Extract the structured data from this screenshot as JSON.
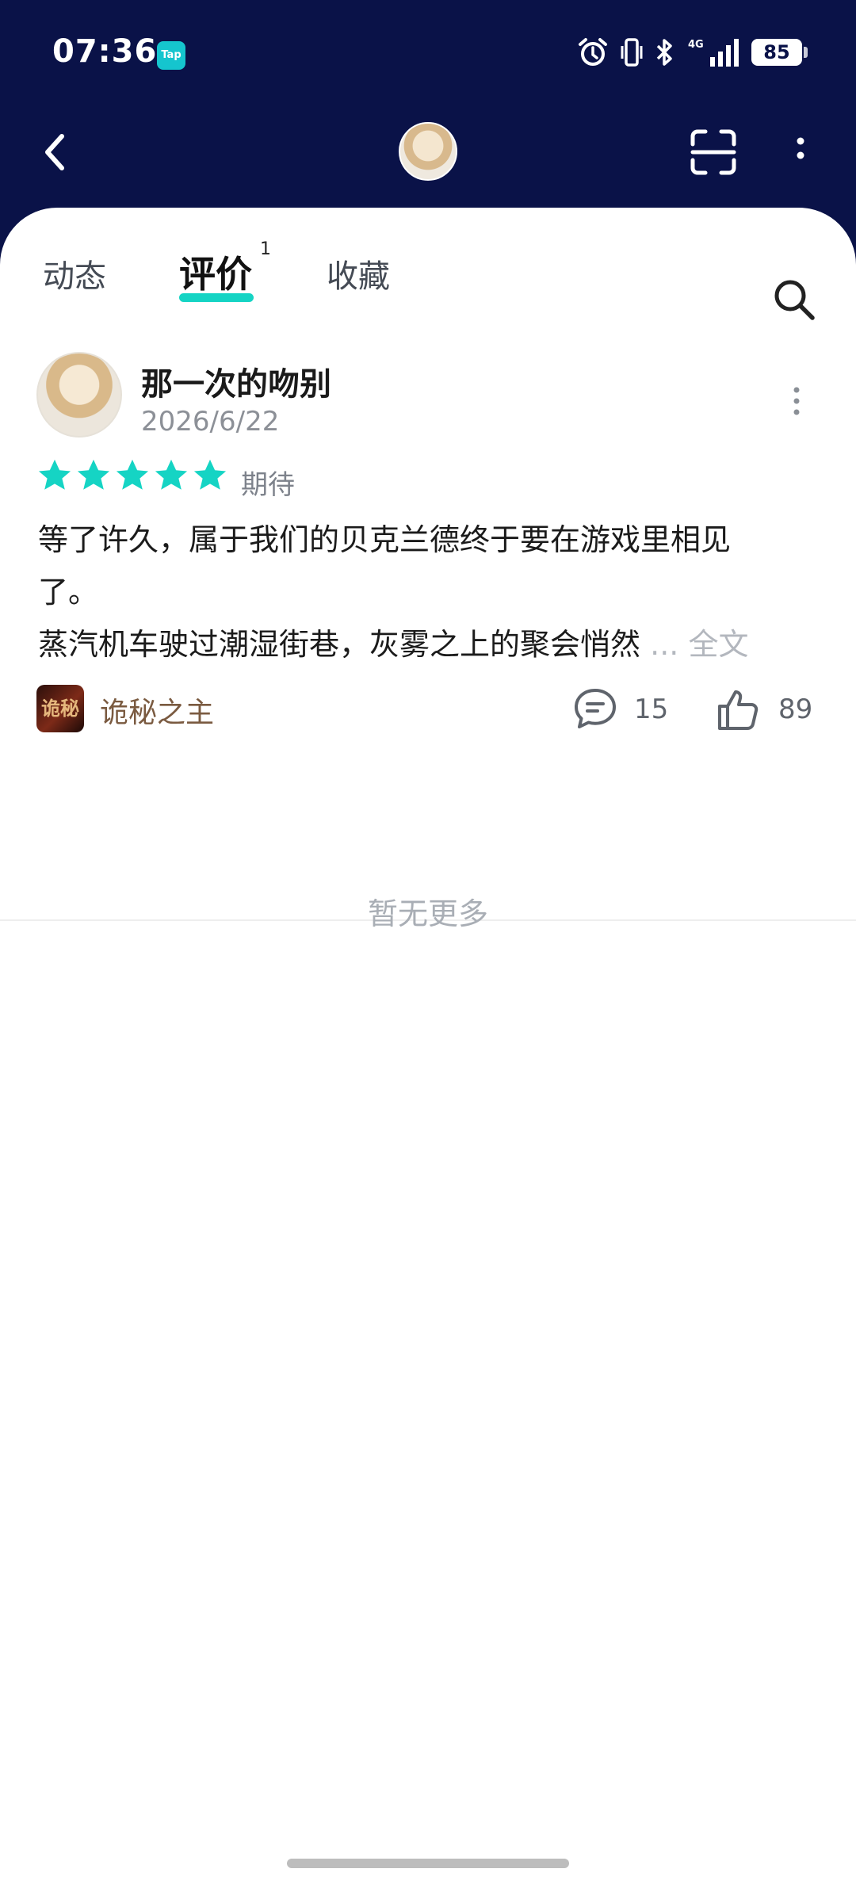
{
  "status_bar": {
    "time": "07:36",
    "app_badge": "Tap",
    "battery": "85",
    "network": "4G",
    "icons": [
      "alarm-icon",
      "vibrate-icon",
      "bluetooth-icon",
      "signal-icon",
      "battery-icon"
    ]
  },
  "header": {
    "icons": [
      "back-icon",
      "scan-icon",
      "more-vertical-icon"
    ]
  },
  "tabs": [
    {
      "label": "动态"
    },
    {
      "label": "评价",
      "count": "1",
      "active": true
    },
    {
      "label": "收藏"
    }
  ],
  "review": {
    "username": "那一次的吻别",
    "date": "2026/6/22",
    "rating": 5,
    "rating_max": 5,
    "rating_label": "期待",
    "text_lines": [
      "等了许久，属于我们的贝克兰德终于要在游戏里相见",
      "了。",
      "蒸汽机车驶过潮湿街巷，灰雾之上的聚会悄然"
    ],
    "ellipsis": "...",
    "full_text_label": "全文",
    "game_icon_text": "诡秘",
    "game_name": "诡秘之主",
    "comment_count": "15",
    "like_count": "89"
  },
  "footer": {
    "no_more": "暂无更多"
  },
  "colors": {
    "header_bg": "#0a1248",
    "accent": "#15d4c4",
    "star": "#15d4c4",
    "game_name": "#7a5a40"
  }
}
